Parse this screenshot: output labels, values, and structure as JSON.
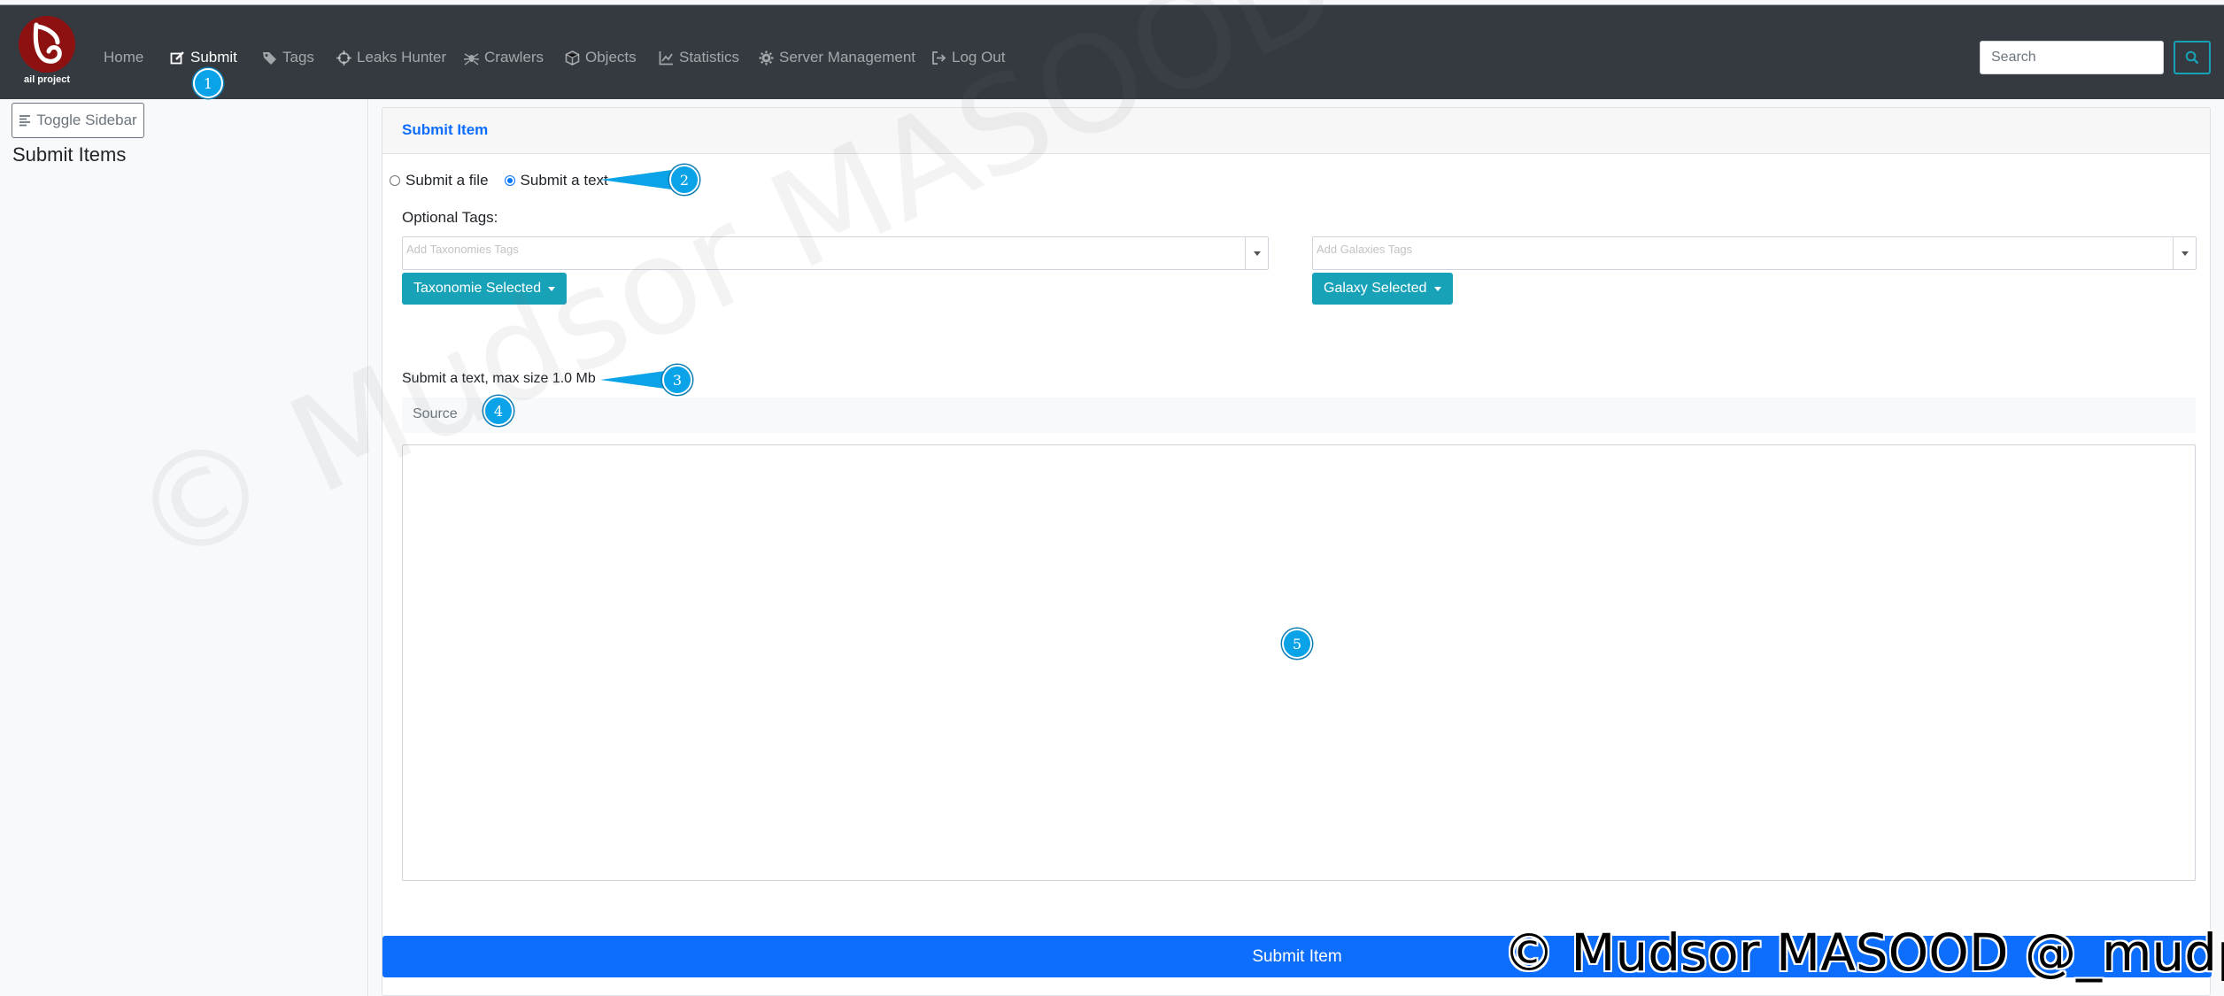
{
  "brand": {
    "logo_text": "ail project",
    "logo_color": "#8e1111"
  },
  "nav": {
    "items": [
      {
        "label": "Home",
        "icon": "none"
      },
      {
        "label": "Submit",
        "icon": "edit-icon",
        "active": true
      },
      {
        "label": "Tags",
        "icon": "tag-icon"
      },
      {
        "label": "Leaks Hunter",
        "icon": "crosshairs-icon"
      },
      {
        "label": "Crawlers",
        "icon": "spider-icon"
      },
      {
        "label": "Objects",
        "icon": "cube-icon"
      },
      {
        "label": "Statistics",
        "icon": "chart-icon"
      },
      {
        "label": "Server Management",
        "icon": "cog-icon"
      },
      {
        "label": "Log Out",
        "icon": "sign-out-icon"
      }
    ],
    "search_placeholder": "Search",
    "search_button_icon": "search-icon"
  },
  "sidebar": {
    "toggle_label": "Toggle Sidebar",
    "title": "Submit Items"
  },
  "card": {
    "title": "Submit Item",
    "radio_file_label": "Submit a file",
    "radio_text_label": "Submit a text",
    "selected_mode": "text",
    "optional_tags_label": "Optional Tags:",
    "taxonomies_placeholder": "Add Taxonomies Tags",
    "galaxies_placeholder": "Add Galaxies Tags",
    "taxonomie_button": "Taxonomie Selected",
    "galaxy_button": "Galaxy Selected",
    "text_label": "Submit a text, max size 1.0 Mb",
    "source_placeholder": "Source",
    "paste_value": "",
    "submit_button": "Submit Item"
  },
  "annotations": [
    "1",
    "2",
    "3",
    "4",
    "5"
  ],
  "watermark": {
    "diagonal": "© Mudsor MASOOD @_mudpak",
    "corner": "© Mudsor MASOOD @_mudpak"
  },
  "colors": {
    "navbar": "#343a40",
    "primary": "#0d6efd",
    "info": "#17a2b8",
    "marker": "#0aa3e8"
  }
}
